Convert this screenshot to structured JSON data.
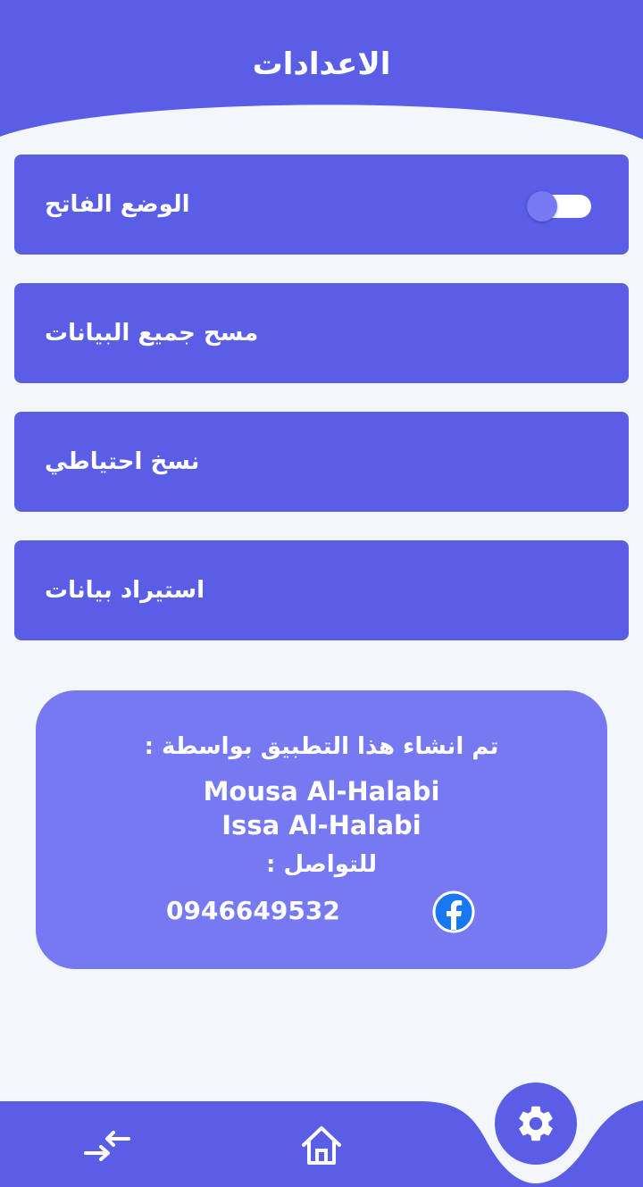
{
  "header": {
    "title": "الاعدادات"
  },
  "settings": {
    "items": [
      {
        "label": "الوضع الفاتح",
        "toggle_on": false
      },
      {
        "label": "مسح جميع البيانات"
      },
      {
        "label": "نسخ احتياطي"
      },
      {
        "label": "استيراد بيانات"
      }
    ]
  },
  "about": {
    "created_by": "تم انشاء هذا التطبيق بواسطة :",
    "author1": "Mousa Al-Halabi",
    "author2": "Issa Al-Halabi",
    "contact_label": "للتواصل :",
    "phone": "0946649532",
    "social_icon": "facebook-icon"
  },
  "bottom_nav": {
    "items": [
      {
        "icon": "transfer-arrows-icon",
        "active": false
      },
      {
        "icon": "home-icon",
        "active": false
      },
      {
        "icon": "gear-icon",
        "active": true
      }
    ]
  },
  "colors": {
    "primary": "#5a5de6",
    "secondary": "#7679f2",
    "background": "#f3f7fb",
    "text": "#ffffff"
  }
}
